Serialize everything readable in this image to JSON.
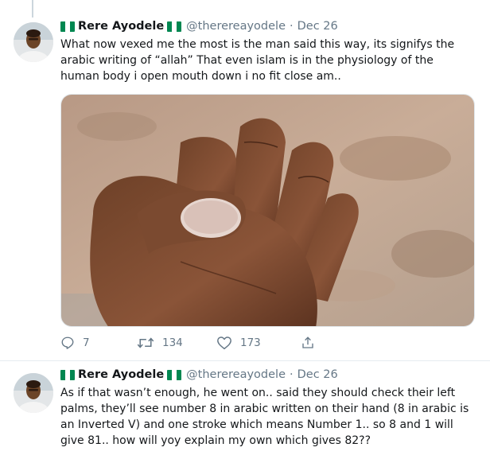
{
  "tweets": [
    {
      "name": "Rere Ayodele",
      "handle": "@therereayodele",
      "separator": "·",
      "date": "Dec 26",
      "text": "What now vexed me the most is the man said this way, its signifys the arabic writing of “allah” That even islam is in the physiology of the human body i open mouth down i no fit close am..",
      "media_icon": "photo-of-hand-palm",
      "counts": {
        "replies": "7",
        "retweets": "134",
        "likes": "173"
      }
    },
    {
      "name": "Rere Ayodele",
      "handle": "@therereayodele",
      "separator": "·",
      "date": "Dec 26",
      "text": "As if that wasn’t enough, he went on.. said they should check their left palms, they’ll see number 8 in arabic written on their hand (8 in arabic is an Inverted V) and one stroke which means Number 1.. so 8 and 1 will give 81.. how will yoy explain my own which gives 82??"
    }
  ],
  "icons": {
    "reply": "reply-icon",
    "retweet": "retweet-icon",
    "like": "heart-icon",
    "share": "share-icon",
    "flag": "nigeria-flag-icon"
  },
  "colors": {
    "text": "#14171a",
    "secondary": "#657786",
    "flag_green": "#008751",
    "divider": "#e6ecf0"
  }
}
